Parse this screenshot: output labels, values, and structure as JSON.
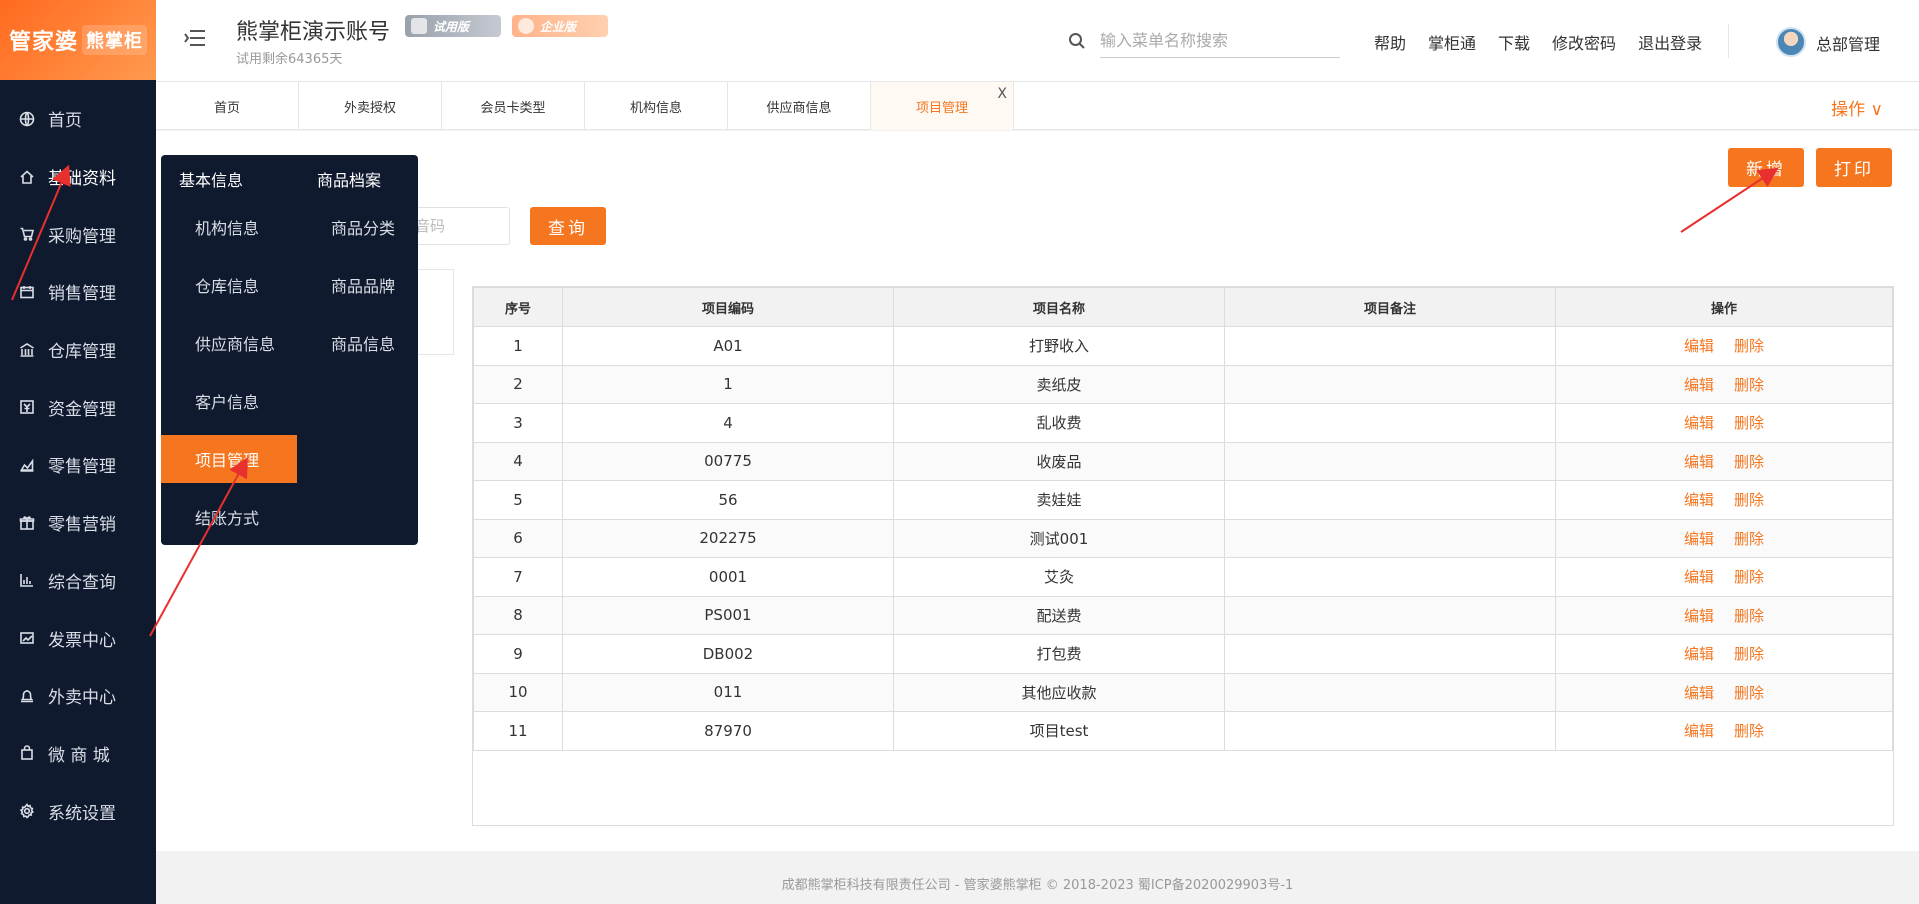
{
  "logo": {
    "main": "管家婆",
    "sub": "熊掌柜"
  },
  "sidebar": {
    "items": [
      {
        "label": "首页",
        "icon": "globe-icon"
      },
      {
        "label": "基础资料",
        "icon": "home-icon"
      },
      {
        "label": "采购管理",
        "icon": "cart-icon"
      },
      {
        "label": "销售管理",
        "icon": "calendar-icon"
      },
      {
        "label": "仓库管理",
        "icon": "bank-icon"
      },
      {
        "label": "资金管理",
        "icon": "money-icon"
      },
      {
        "label": "零售管理",
        "icon": "area-chart-icon"
      },
      {
        "label": "零售营销",
        "icon": "gift-icon"
      },
      {
        "label": "综合查询",
        "icon": "bar-chart-icon"
      },
      {
        "label": "发票中心",
        "icon": "line-chart-icon"
      },
      {
        "label": "外卖中心",
        "icon": "bell-icon"
      },
      {
        "label": "微 商 城",
        "icon": "shopping-bag-icon"
      },
      {
        "label": "系统设置",
        "icon": "gear-icon"
      }
    ]
  },
  "header": {
    "account_title": "熊掌柜演示账号",
    "trial_text": "试用剩余64365天",
    "badge_trial": "试用版",
    "badge_enterprise": "企业版",
    "search_placeholder": "输入菜单名称搜索",
    "links": [
      "帮助",
      "掌柜通",
      "下载",
      "修改密码",
      "退出登录"
    ],
    "user_name": "总部管理"
  },
  "tabs": {
    "items": [
      {
        "label": "首页"
      },
      {
        "label": "外卖授权"
      },
      {
        "label": "会员卡类型"
      },
      {
        "label": "机构信息"
      },
      {
        "label": "供应商信息"
      },
      {
        "label": "项目管理"
      }
    ],
    "close": "X",
    "ops_label": "操作 ∨"
  },
  "flyout": {
    "col1_title": "基本信息",
    "col2_title": "商品档案",
    "col1": [
      "机构信息",
      "仓库信息",
      "供应商信息",
      "客户信息",
      "项目管理",
      "结账方式"
    ],
    "col2": [
      "商品分类",
      "商品品牌",
      "商品信息"
    ]
  },
  "toolbar": {
    "add_label": "新增",
    "print_label": "打印",
    "query_label": "查询",
    "code_placeholder": "音码"
  },
  "table": {
    "columns": [
      "序号",
      "项目编码",
      "项目名称",
      "项目备注",
      "操作"
    ],
    "rows": [
      [
        "1",
        "A01",
        "打野收入",
        ""
      ],
      [
        "2",
        "1",
        "卖纸皮",
        ""
      ],
      [
        "3",
        "4",
        "乱收费",
        ""
      ],
      [
        "4",
        "00775",
        "收废品",
        ""
      ],
      [
        "5",
        "56",
        "卖娃娃",
        ""
      ],
      [
        "6",
        "202275",
        "测试001",
        ""
      ],
      [
        "7",
        "0001",
        "艾灸",
        ""
      ],
      [
        "8",
        "PS001",
        "配送费",
        ""
      ],
      [
        "9",
        "DB002",
        "打包费",
        ""
      ],
      [
        "10",
        "011",
        "其他应收款",
        ""
      ],
      [
        "11",
        "87970",
        "项目test",
        ""
      ]
    ],
    "edit_label": "编辑",
    "delete_label": "删除"
  },
  "footer": {
    "text": "成都熊掌柜科技有限责任公司 - 管家婆熊掌柜 © 2018-2023 蜀ICP备2020029903号-1"
  },
  "colors": {
    "accent": "#f5761f",
    "sidebar_bg": "#0f1a2e",
    "arrow": "#e8302f"
  }
}
